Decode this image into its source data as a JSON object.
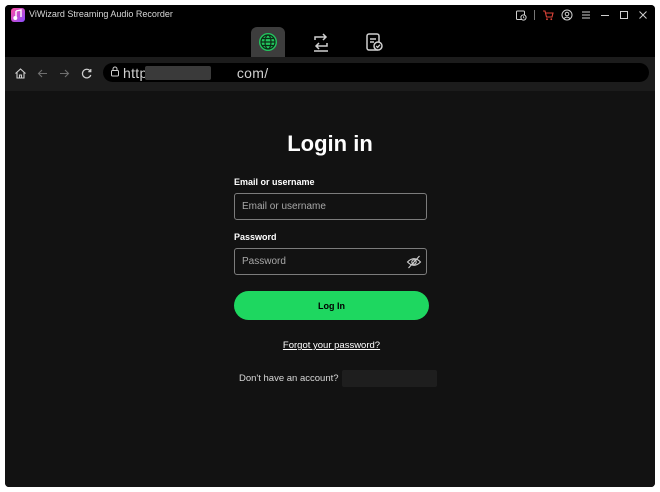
{
  "window": {
    "title": "ViWizard Streaming Audio Recorder"
  },
  "toolbar": {
    "icons": [
      "history-icon",
      "cart-icon",
      "account-icon",
      "menu-icon",
      "minimize-icon",
      "maximize-icon",
      "close-icon"
    ],
    "mode_tabs": [
      {
        "icon": "globe-icon",
        "active": true
      },
      {
        "icon": "convert-icon",
        "active": false
      },
      {
        "icon": "converted-list-icon",
        "active": false
      }
    ],
    "accent_color": "#22c55e"
  },
  "navigation": {
    "icons": [
      "home-icon",
      "back-icon",
      "forward-icon",
      "refresh-icon",
      "lock-icon"
    ],
    "url_visible_start": "https",
    "url_visible_end": "com/"
  },
  "login": {
    "title": "Login in",
    "email_label": "Email or username",
    "email_placeholder": "Email or username",
    "email_value": "",
    "password_label": "Password",
    "password_placeholder": "Password",
    "password_value": "",
    "login_button": "Log In",
    "login_button_color": "#1ed760",
    "forgot_password": "Forgot your password?",
    "no_account_text": "Don't have an account?"
  }
}
